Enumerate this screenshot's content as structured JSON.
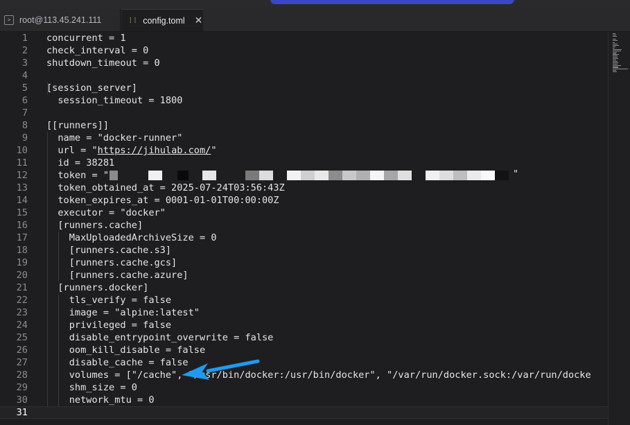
{
  "tabs": [
    {
      "label": "root@113.45.241.111",
      "icon": "terminal-icon"
    },
    {
      "label": "config.toml",
      "icon": "toml-file-icon",
      "active": true
    }
  ],
  "editor": {
    "lines": [
      {
        "n": "1",
        "text": "concurrent = 1"
      },
      {
        "n": "2",
        "text": "check_interval = 0"
      },
      {
        "n": "3",
        "text": "shutdown_timeout = 0"
      },
      {
        "n": "4",
        "text": ""
      },
      {
        "n": "5",
        "text": "[session_server]"
      },
      {
        "n": "6",
        "text": "  session_timeout = 1800"
      },
      {
        "n": "7",
        "text": ""
      },
      {
        "n": "8",
        "text": "[[runners]]"
      },
      {
        "n": "9",
        "text": "  name = \"docker-runner\""
      },
      {
        "n": "10",
        "text": "  url = \"https://jihulab.com/\""
      },
      {
        "n": "11",
        "text": "  id = 38281"
      },
      {
        "n": "12",
        "text": "  token = \""
      },
      {
        "n": "13",
        "text": "  token_obtained_at = 2025-07-24T03:56:43Z"
      },
      {
        "n": "14",
        "text": "  token_expires_at = 0001-01-01T00:00:00Z"
      },
      {
        "n": "15",
        "text": "  executor = \"docker\""
      },
      {
        "n": "16",
        "text": "  [runners.cache]"
      },
      {
        "n": "17",
        "text": "    MaxUploadedArchiveSize = 0"
      },
      {
        "n": "18",
        "text": "    [runners.cache.s3]"
      },
      {
        "n": "19",
        "text": "    [runners.cache.gcs]"
      },
      {
        "n": "20",
        "text": "    [runners.cache.azure]"
      },
      {
        "n": "21",
        "text": "  [runners.docker]"
      },
      {
        "n": "22",
        "text": "    tls_verify = false"
      },
      {
        "n": "23",
        "text": "    image = \"alpine:latest\""
      },
      {
        "n": "24",
        "text": "    privileged = false"
      },
      {
        "n": "25",
        "text": "    disable_entrypoint_overwrite = false"
      },
      {
        "n": "26",
        "text": "    oom_kill_disable = false"
      },
      {
        "n": "27",
        "text": "    disable_cache = false"
      },
      {
        "n": "28",
        "text": "    volumes = [\"/cache\", \"/usr/bin/docker:/usr/bin/docker\", \"/var/run/docker.sock:/var/run/docke"
      },
      {
        "n": "29",
        "text": "    shm_size = 0"
      },
      {
        "n": "30",
        "text": "    network_mtu = 0"
      },
      {
        "n": "31",
        "text": ""
      }
    ],
    "url_prefix": "  url = \"",
    "url_text": "https://jihulab.com/",
    "url_suffix": "\"",
    "token_closing_quote": "\""
  },
  "annotation": {
    "icon": "arrow-icon",
    "color": "#1e9bf0"
  }
}
